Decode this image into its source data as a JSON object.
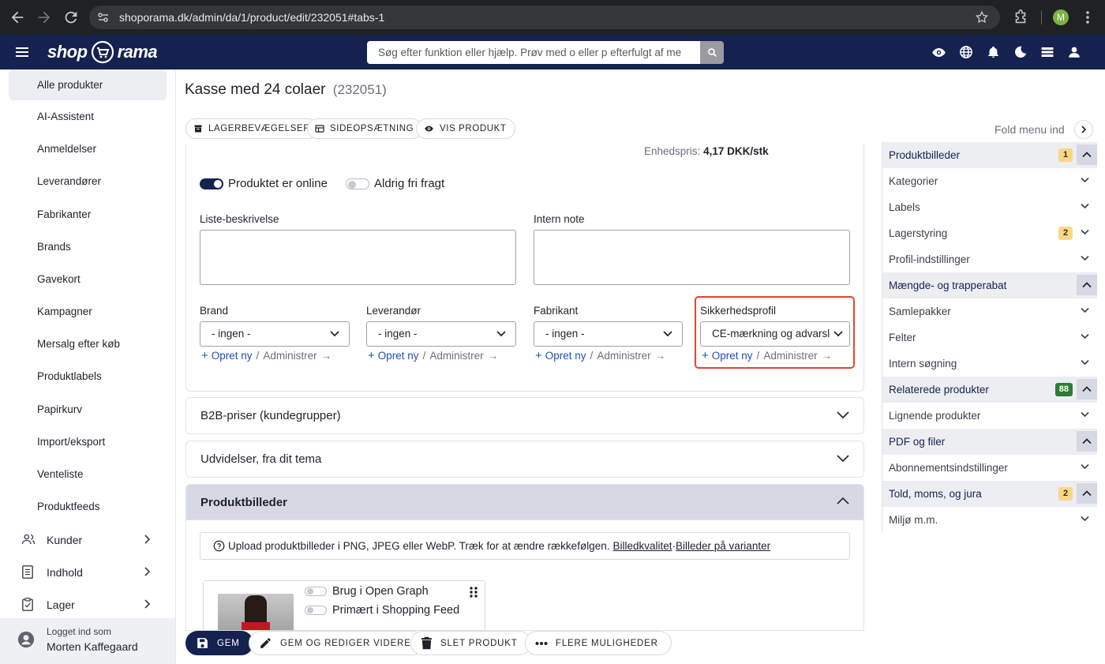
{
  "browser": {
    "url": "shoporama.dk/admin/da/1/product/edit/232051#tabs-1",
    "profile_initial": "M"
  },
  "header": {
    "logo_left": "shop",
    "logo_right": "rama",
    "search_placeholder": "Søg efter funktion eller hjælp. Prøv med o eller p efterfulgt af me"
  },
  "sidebar": {
    "items": [
      {
        "label": "Alle produkter",
        "active": true
      },
      {
        "label": "AI-Assistent"
      },
      {
        "label": "Anmeldelser"
      },
      {
        "label": "Leverandører"
      },
      {
        "label": "Fabrikanter"
      },
      {
        "label": "Brands"
      },
      {
        "label": "Gavekort"
      },
      {
        "label": "Kampagner"
      },
      {
        "label": "Mersalg efter køb"
      },
      {
        "label": "Produktlabels"
      },
      {
        "label": "Papirkurv"
      },
      {
        "label": "Import/eksport"
      },
      {
        "label": "Venteliste"
      },
      {
        "label": "Produktfeeds"
      }
    ],
    "groups": [
      {
        "label": "Kunder",
        "icon": "users-icon"
      },
      {
        "label": "Indhold",
        "icon": "document-icon"
      },
      {
        "label": "Lager",
        "icon": "clipboard-icon"
      }
    ],
    "user": {
      "logged_in_label": "Logget ind som",
      "name": "Morten Kaffegaard"
    }
  },
  "main": {
    "title": "Kasse med 24 colaer",
    "product_id": "(232051)",
    "pills": [
      "LAGERBEVÆGELSER",
      "SIDEOPSÆTNING",
      "VIS PRODUKT"
    ],
    "unit_price_label": "Enhedspris:",
    "unit_price_value": "4,17 DKK/stk",
    "toggles": [
      {
        "label": "Produktet er online",
        "on": true
      },
      {
        "label": "Aldrig fri fragt",
        "on": false
      }
    ],
    "list_description_label": "Liste-beskrivelse",
    "internal_note_label": "Intern note",
    "selects": [
      {
        "label": "Brand",
        "value": "- ingen -"
      },
      {
        "label": "Leverandør",
        "value": "- ingen -"
      },
      {
        "label": "Fabrikant",
        "value": "- ingen -"
      },
      {
        "label": "Sikkerhedsprofil",
        "value": "CE-mærkning og advarsler"
      }
    ],
    "create_new": "Opret ny",
    "manage": "Administrer",
    "accordions": [
      "B2B-priser (kundegrupper)",
      "Udvidelser, fra dit tema",
      "Produktbilleder"
    ],
    "upload_info": "Upload produktbilleder i PNG, JPEG eller WebP. Træk for at ændre rækkefølgen.",
    "image_quality_link": "Billedkvalitet",
    "dot": "·",
    "variant_images_link": "Billeder på varianter",
    "image_options": [
      "Brug i Open Graph",
      "Primært i Shopping Feed"
    ]
  },
  "actions": {
    "save": "GEM",
    "save_continue": "GEM OG REDIGER VIDERE",
    "delete": "SLET PRODUKT",
    "more": "FLERE MULIGHEDER"
  },
  "right_panel": {
    "fold_label": "Fold menu ind",
    "items": [
      {
        "label": "Produktbilleder",
        "section": true,
        "badge": "1",
        "badge_color": "yellow"
      },
      {
        "label": "Kategorier"
      },
      {
        "label": "Labels"
      },
      {
        "label": "Lagerstyring",
        "badge": "2",
        "badge_color": "yellow"
      },
      {
        "label": "Profil-indstillinger"
      },
      {
        "label": "Mængde- og trapperabat",
        "section": true
      },
      {
        "label": "Samlepakker"
      },
      {
        "label": "Felter"
      },
      {
        "label": "Intern søgning"
      },
      {
        "label": "Relaterede produkter",
        "section": true,
        "badge": "88",
        "badge_color": "green"
      },
      {
        "label": "Lignende produkter"
      },
      {
        "label": "PDF og filer",
        "section": true
      },
      {
        "label": "Abonnementsindstillinger"
      },
      {
        "label": "Told, moms, og jura",
        "section": true,
        "badge": "2",
        "badge_color": "yellow"
      },
      {
        "label": "Miljø m.m."
      }
    ]
  },
  "colors": {
    "brand_navy": "#152250",
    "highlight_red": "#e2482f",
    "link_blue": "#1f4fb8",
    "badge_yellow": "#f7d88a",
    "badge_green": "#2e7d32"
  }
}
